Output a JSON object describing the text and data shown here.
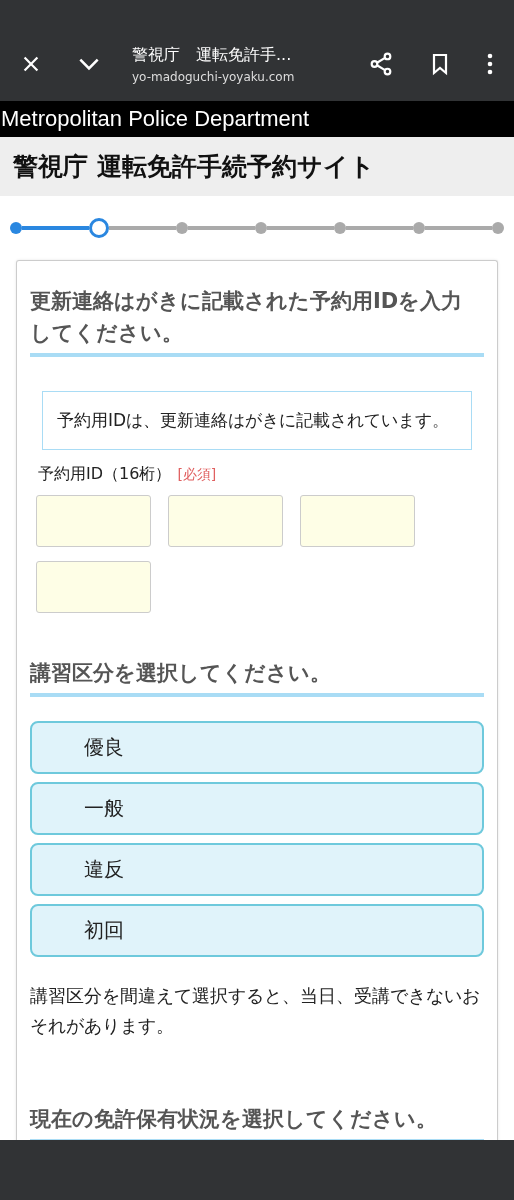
{
  "browser": {
    "title": "警視庁　運転免許手...",
    "url": "yo-madoguchi-yoyaku.com"
  },
  "banner": "Metropolitan Police Department",
  "site_title": "警視庁 運転免許手続予約サイト",
  "steps": [
    {
      "kind": "done"
    },
    {
      "kind": "current"
    },
    {
      "kind": "todo"
    },
    {
      "kind": "todo"
    },
    {
      "kind": "todo"
    },
    {
      "kind": "todo"
    },
    {
      "kind": "todo"
    }
  ],
  "id_section": {
    "heading": "更新連絡はがきに記載された予約用IDを入力してください。",
    "note": "予約用IDは、更新連絡はがきに記載されています。",
    "label": "予約用ID（16桁）",
    "required": "[必須]",
    "fields": [
      {
        "kind": "text"
      },
      {
        "kind": "text"
      },
      {
        "kind": "text"
      },
      {
        "kind": "text"
      }
    ]
  },
  "course_section": {
    "heading": "講習区分を選択してください。",
    "options": [
      {
        "label": "優良",
        "selected": false
      },
      {
        "label": "一般",
        "selected": false
      },
      {
        "label": "違反",
        "selected": false
      },
      {
        "label": "初回",
        "selected": false
      }
    ],
    "warning": "講習区分を間違えて選択すると、当日、受講できないおそれがあります。"
  },
  "license_section": {
    "heading": "現在の免許保有状況を選択してください。"
  }
}
